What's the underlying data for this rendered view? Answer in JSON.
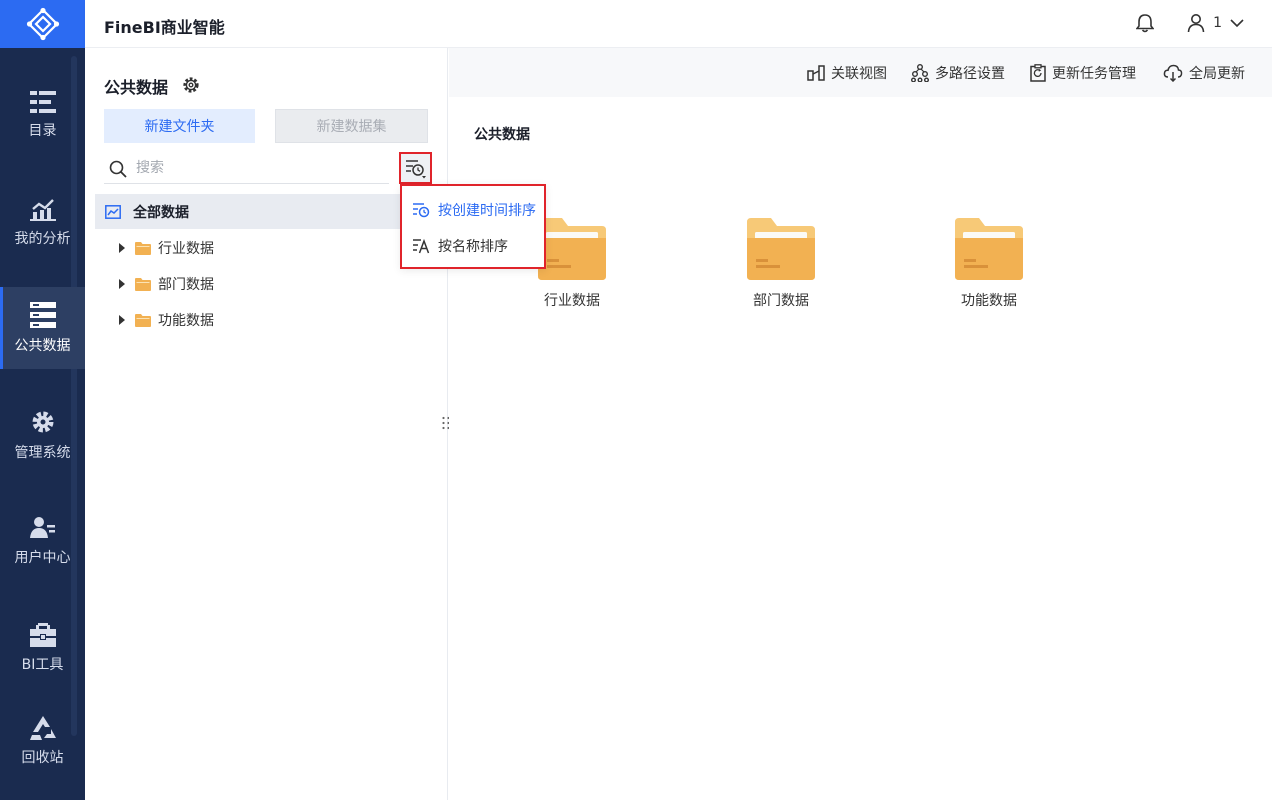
{
  "colors": {
    "brand": "#2c6bf2",
    "rail_bg": "#1a2b4f",
    "highlight_border": "#e0242b",
    "folder": "#f2b152"
  },
  "header": {
    "title": "FineBI商业智能",
    "user_label": "1"
  },
  "rail": {
    "items": [
      {
        "label": "目录",
        "icon": "catalog-icon"
      },
      {
        "label": "我的分析",
        "icon": "chart-icon"
      },
      {
        "label": "公共数据",
        "icon": "database-icon",
        "active": true
      },
      {
        "label": "管理系统",
        "icon": "gear-icon"
      },
      {
        "label": "用户中心",
        "icon": "user-card-icon"
      },
      {
        "label": "BI工具",
        "icon": "toolbox-icon"
      },
      {
        "label": "回收站",
        "icon": "recycle-icon"
      }
    ]
  },
  "left_panel": {
    "title": "公共数据",
    "new_folder": "新建文件夹",
    "new_dataset": "新建数据集",
    "search_placeholder": "搜索",
    "tree_root": "全部数据",
    "tree": [
      "行业数据",
      "部门数据",
      "功能数据"
    ],
    "sort_menu": [
      "按创建时间排序",
      "按名称排序"
    ]
  },
  "toolbar": {
    "items": [
      "关联视图",
      "多路径设置",
      "更新任务管理",
      "全局更新"
    ]
  },
  "main": {
    "section_title": "公共数据",
    "folders": [
      "行业数据",
      "部门数据",
      "功能数据"
    ]
  }
}
